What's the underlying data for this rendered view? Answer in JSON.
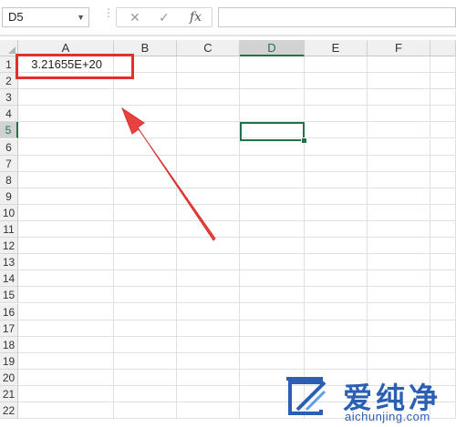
{
  "formula_bar": {
    "name_box": "D5",
    "cancel_glyph": "✕",
    "enter_glyph": "✓",
    "fx_label": "fx",
    "formula_value": ""
  },
  "columns": [
    "A",
    "B",
    "C",
    "D",
    "E",
    "F"
  ],
  "rows": [
    "1",
    "2",
    "3",
    "4",
    "5",
    "6",
    "7",
    "8",
    "9",
    "10",
    "11",
    "12",
    "13",
    "14",
    "15",
    "16",
    "17",
    "18",
    "19",
    "20",
    "21",
    "22"
  ],
  "selected_column": "D",
  "selected_row": "5",
  "cells": {
    "A1": "3.21655E+20"
  },
  "annotation": {
    "color": "#e03030"
  },
  "watermark": {
    "chinese": "爱纯净",
    "url": "aichunjing.com",
    "color": "#2b5fb3"
  },
  "accent_color": "#217346"
}
